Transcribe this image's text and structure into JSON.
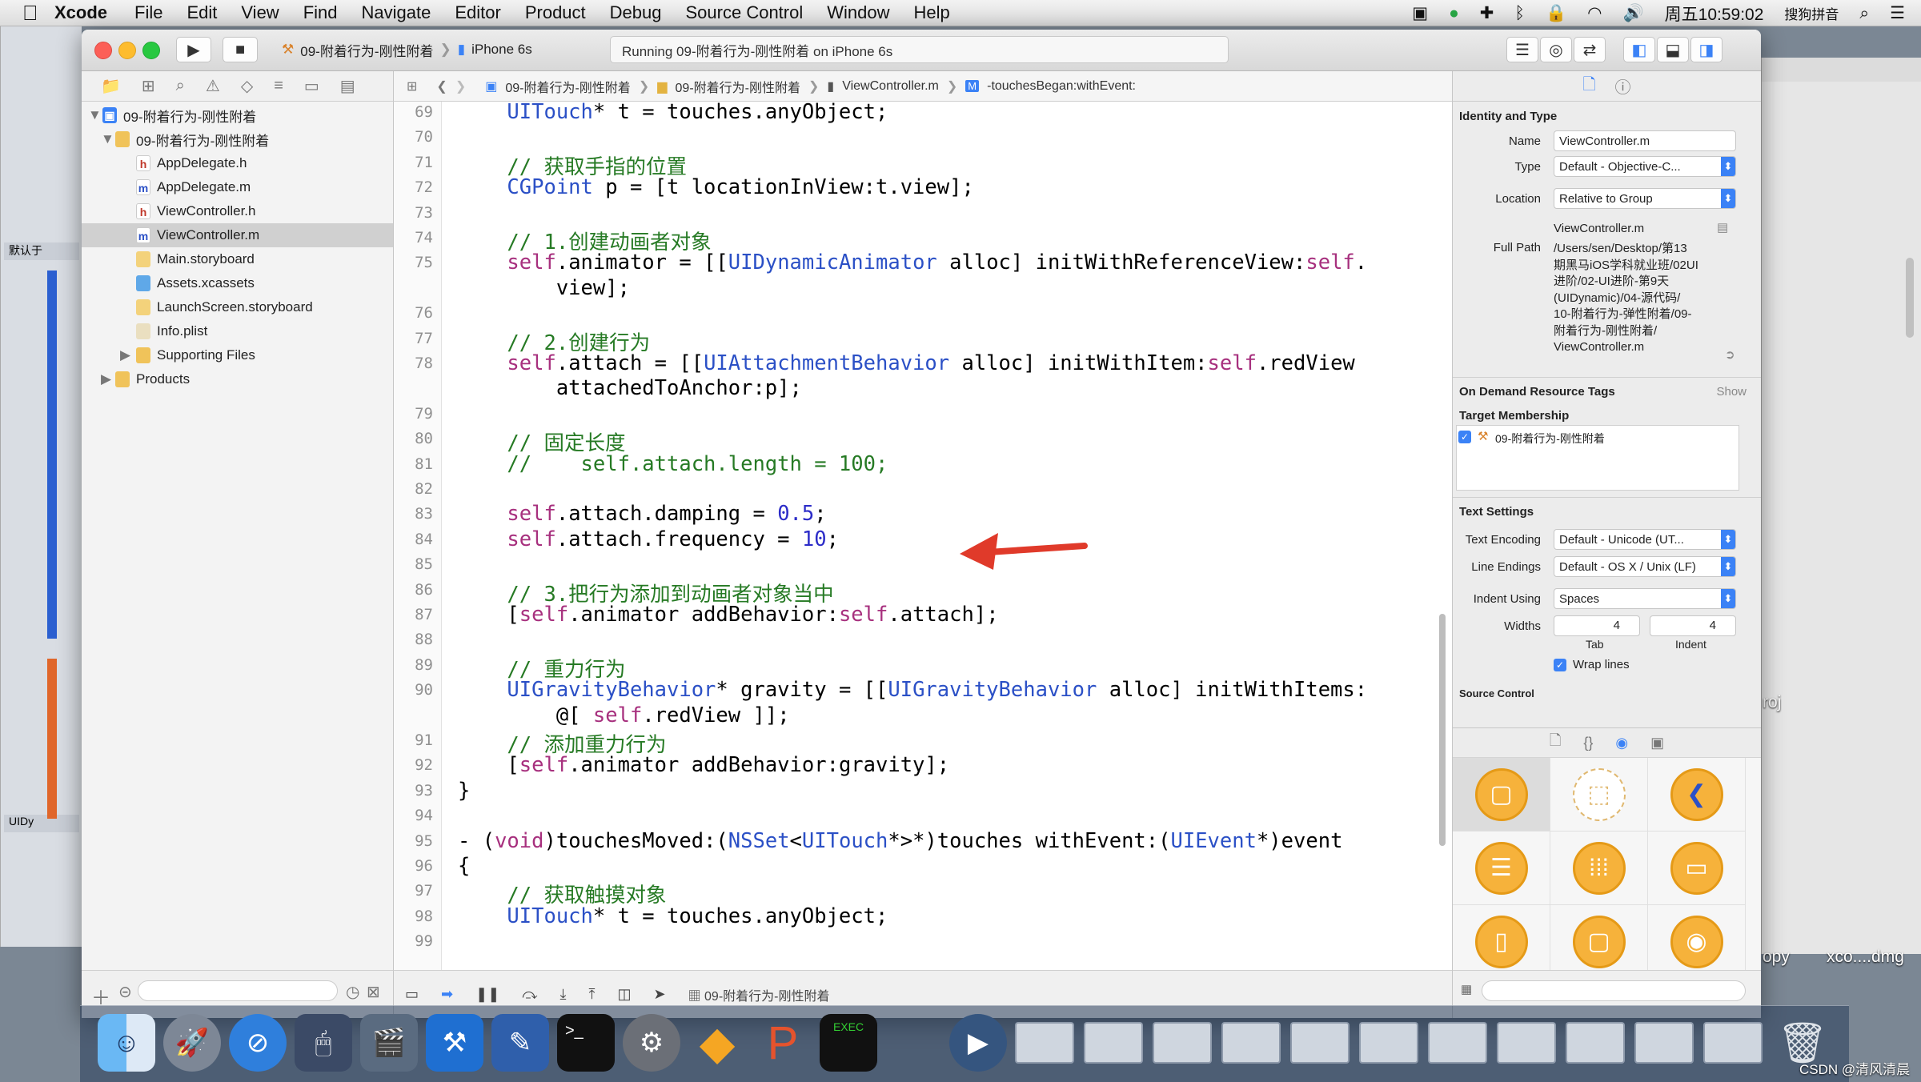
{
  "menubar": {
    "app": "Xcode",
    "items": [
      "File",
      "Edit",
      "View",
      "Find",
      "Navigate",
      "Editor",
      "Product",
      "Debug",
      "Source Control",
      "Window",
      "Help"
    ],
    "clock": "周五10:59:02",
    "input_method": "搜狗拼音"
  },
  "toolbar": {
    "scheme": "09-附着行为-刚性附着",
    "device": "iPhone 6s",
    "status": "Running 09-附着行为-刚性附着 on iPhone 6s"
  },
  "navigator": {
    "items": [
      {
        "label": "09-附着行为-刚性附着",
        "level": 0,
        "kind": "project",
        "disclosure": "open"
      },
      {
        "label": "09-附着行为-刚性附着",
        "level": 1,
        "kind": "folder",
        "disclosure": "open"
      },
      {
        "label": "AppDelegate.h",
        "level": 2,
        "kind": "h"
      },
      {
        "label": "AppDelegate.m",
        "level": 2,
        "kind": "m"
      },
      {
        "label": "ViewController.h",
        "level": 2,
        "kind": "h"
      },
      {
        "label": "ViewController.m",
        "level": 2,
        "kind": "m",
        "selected": true
      },
      {
        "label": "Main.storyboard",
        "level": 2,
        "kind": "storyboard"
      },
      {
        "label": "Assets.xcassets",
        "level": 2,
        "kind": "assets"
      },
      {
        "label": "LaunchScreen.storyboard",
        "level": 2,
        "kind": "storyboard"
      },
      {
        "label": "Info.plist",
        "level": 2,
        "kind": "plist"
      },
      {
        "label": "Supporting Files",
        "level": 2,
        "kind": "folder",
        "disclosure": "closed"
      },
      {
        "label": "Products",
        "level": 1,
        "kind": "folder",
        "disclosure": "closed"
      }
    ]
  },
  "jumpbar": {
    "crumbs": [
      "09-附着行为-刚性附着",
      "09-附着行为-刚性附着",
      "ViewController.m",
      "-touchesBegan:withEvent:"
    ]
  },
  "editor": {
    "line_numbers": [
      "69",
      "70",
      "71",
      "72",
      "73",
      "74",
      "75",
      "76",
      "77",
      "78",
      "79",
      "80",
      "81",
      "82",
      "83",
      "84",
      "85",
      "86",
      "87",
      "88",
      "89",
      "90",
      "91",
      "92",
      "93",
      "94",
      "95",
      "96",
      "97",
      "98",
      "99"
    ],
    "lines": [
      "    UITouch* t = touches.anyObject;",
      "",
      "    // 获取手指的位置",
      "    CGPoint p = [t locationInView:t.view];",
      "",
      "    // 1.创建动画者对象",
      "    self.animator = [[UIDynamicAnimator alloc] initWithReferenceView:self.",
      "        view];",
      "",
      "    // 2.创建行为",
      "    self.attach = [[UIAttachmentBehavior alloc] initWithItem:self.redView",
      "        attachedToAnchor:p];",
      "",
      "    // 固定长度",
      "    //    self.attach.length = 100;",
      "",
      "    self.attach.damping = 0.5;",
      "    self.attach.frequency = 10;",
      "",
      "    // 3.把行为添加到动画者对象当中",
      "    [self.animator addBehavior:self.attach];",
      "",
      "    // 重力行为",
      "    UIGravityBehavior* gravity = [[UIGravityBehavior alloc] initWithItems:",
      "        @[ self.redView ]];",
      "    // 添加重力行为",
      "    [self.animator addBehavior:gravity];",
      "}",
      "",
      "- (void)touchesMoved:(NSSet<UITouch*>*)touches withEvent:(UIEvent*)event",
      "{",
      "    // 获取触摸对象",
      "    UITouch* t = touches.anyObject;",
      ""
    ]
  },
  "debugbar": {
    "target": "09-附着行为-刚性附着"
  },
  "inspector": {
    "identity_header": "Identity and Type",
    "name_label": "Name",
    "name_value": "ViewController.m",
    "type_label": "Type",
    "type_value": "Default - Objective-C...",
    "location_label": "Location",
    "location_value": "Relative to Group",
    "location_file": "ViewController.m",
    "fullpath_label": "Full Path",
    "fullpath_lines": [
      "/Users/sen/Desktop/第13",
      "期黑马iOS学科就业班/02UI",
      "进阶/02-UI进阶-第9天",
      "(UIDynamic)/04-源代码/",
      "10-附着行为-弹性附着/09-",
      "附着行为-刚性附着/",
      "ViewController.m"
    ],
    "odr_header": "On Demand Resource Tags",
    "odr_show": "Show",
    "target_header": "Target Membership",
    "target_item": "09-附着行为-刚性附着",
    "text_header": "Text Settings",
    "encoding_label": "Text Encoding",
    "encoding_value": "Default - Unicode (UT...",
    "endings_label": "Line Endings",
    "endings_value": "Default - OS X / Unix (LF)",
    "indent_label": "Indent Using",
    "indent_value": "Spaces",
    "widths_label": "Widths",
    "tab_value": "4",
    "indent_num": "4",
    "tab_caption": "Tab",
    "indent_caption": "Indent",
    "wrap_label": "Wrap lines",
    "source_header": "Source Control"
  },
  "desktop": {
    "label1": "roj",
    "label2": "opy",
    "label3": "xco....dmg",
    "watermark": "CSDN @清风清晨",
    "bg_label1": "默认于",
    "bg_label2": "UIDy"
  },
  "colors": {
    "keyword": "#a7307e",
    "type": "#2b50c6",
    "comment": "#267a24",
    "number": "#2c2cc8",
    "arrow": "#e03a2a",
    "selection": "#d0d0d0"
  }
}
